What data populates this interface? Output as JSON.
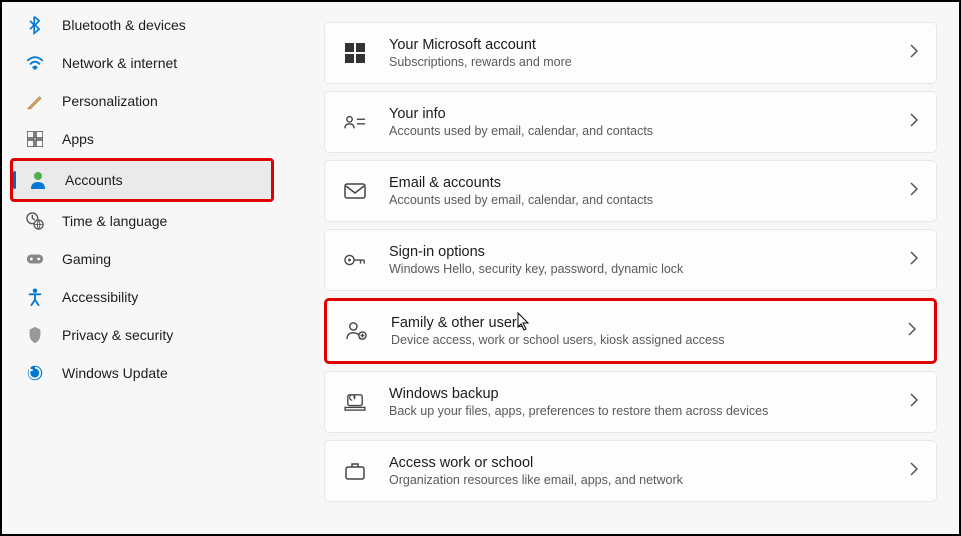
{
  "sidebar": {
    "items": [
      {
        "label": "Bluetooth & devices",
        "icon": "bluetooth"
      },
      {
        "label": "Network & internet",
        "icon": "wifi"
      },
      {
        "label": "Personalization",
        "icon": "brush"
      },
      {
        "label": "Apps",
        "icon": "apps"
      },
      {
        "label": "Accounts",
        "icon": "person",
        "selected": true,
        "highlighted": true
      },
      {
        "label": "Time & language",
        "icon": "clock"
      },
      {
        "label": "Gaming",
        "icon": "gamepad"
      },
      {
        "label": "Accessibility",
        "icon": "accessibility"
      },
      {
        "label": "Privacy & security",
        "icon": "shield"
      },
      {
        "label": "Windows Update",
        "icon": "update"
      }
    ]
  },
  "main": {
    "cards": [
      {
        "title": "Your Microsoft account",
        "sub": "Subscriptions, rewards and more",
        "icon": "microsoft"
      },
      {
        "title": "Your info",
        "sub": "Accounts used by email, calendar, and contacts",
        "icon": "id-card"
      },
      {
        "title": "Email & accounts",
        "sub": "Accounts used by email, calendar, and contacts",
        "icon": "mail"
      },
      {
        "title": "Sign-in options",
        "sub": "Windows Hello, security key, password, dynamic lock",
        "icon": "key"
      },
      {
        "title": "Family & other users",
        "sub": "Device access, work or school users, kiosk assigned access",
        "icon": "family",
        "highlighted": true
      },
      {
        "title": "Windows backup",
        "sub": "Back up your files, apps, preferences to restore them across devices",
        "icon": "backup"
      },
      {
        "title": "Access work or school",
        "sub": "Organization resources like email, apps, and network",
        "icon": "briefcase"
      }
    ]
  }
}
